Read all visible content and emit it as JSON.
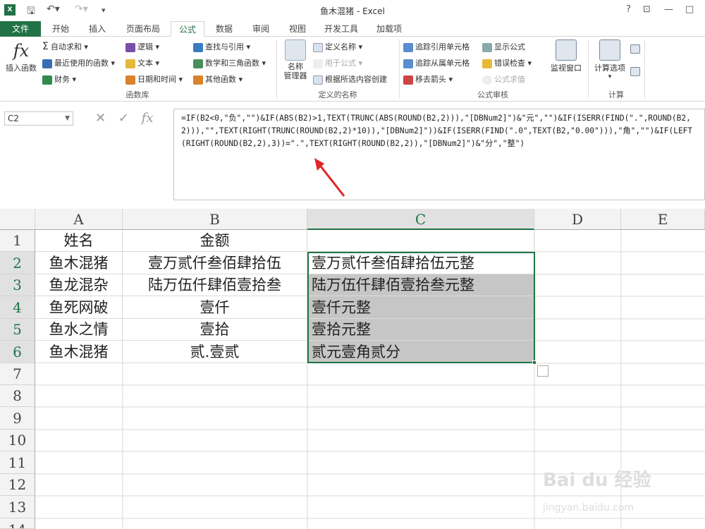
{
  "window": {
    "title": "鱼木混猪 - Excel",
    "help": "?",
    "restore_icon": "restore-icon",
    "min": "—",
    "max": "□"
  },
  "tabs": [
    "文件",
    "开始",
    "插入",
    "页面布局",
    "公式",
    "数据",
    "审阅",
    "视图",
    "开发工具",
    "加载项"
  ],
  "ribbon": {
    "insert_function": "插入函数",
    "autosum": "自动求和",
    "recent": "最近使用的函数",
    "financial": "财务",
    "logical": "逻辑",
    "text": "文本",
    "datetime": "日期和时间",
    "lookup": "查找与引用",
    "math": "数学和三角函数",
    "more": "其他函数",
    "group_function_library": "函数库",
    "name_manager": "名称\n管理器",
    "define_name": "定义名称",
    "use_in_formula": "用于公式",
    "create_from_selection": "根据所选内容创建",
    "group_defined_names": "定义的名称",
    "trace_precedents": "追踪引用单元格",
    "trace_dependents": "追踪从属单元格",
    "remove_arrows": "移去箭头",
    "show_formulas": "显示公式",
    "error_checking": "错误检查",
    "evaluate_formula": "公式求值",
    "group_formula_auditing": "公式审核",
    "watch_window": "监视窗口",
    "calc_options": "计算选项",
    "group_calculation": "计算"
  },
  "name_box": "C2",
  "formula": "=IF(B2<0,\"负\",\"\")&IF(ABS(B2)>1,TEXT(TRUNC(ABS(ROUND(B2,2))),\"[DBNum2]\")&\"元\",\"\")&IF(ISERR(FIND(\".\",ROUND(B2,2))),\"\",TEXT(RIGHT(TRUNC(ROUND(B2,2)*10)),\"[DBNum2]\"))&IF(ISERR(FIND(\".0\",TEXT(B2,\"0.00\"))),\"角\",\"\")&IF(LEFT(RIGHT(ROUND(B2,2),3))=\".\",TEXT(RIGHT(ROUND(B2,2)),\"[DBNum2]\")&\"分\",\"整\")",
  "columns": [
    "A",
    "B",
    "C",
    "D",
    "E"
  ],
  "rows": [
    "1",
    "2",
    "3",
    "4",
    "5",
    "6",
    "7",
    "8",
    "9",
    "10",
    "11",
    "12",
    "13",
    "14"
  ],
  "cells": {
    "r1": [
      "姓名",
      "金额",
      ""
    ],
    "r2": [
      "鱼木混猪",
      "壹万贰仟叁佰肆拾伍",
      "壹万贰仟叁佰肆拾伍元整"
    ],
    "r3": [
      "鱼龙混杂",
      "陆万伍仟肆佰壹拾叁",
      "陆万伍仟肆佰壹拾叁元整"
    ],
    "r4": [
      "鱼死网破",
      "壹仟",
      "壹仟元整"
    ],
    "r5": [
      "鱼水之情",
      "壹拾",
      "壹拾元整"
    ],
    "r6": [
      "鱼木混猪",
      "贰.壹贰",
      "贰元壹角贰分"
    ]
  },
  "watermark": {
    "logo": "Bai du 经验",
    "url": "jingyan.baidu.com"
  },
  "colors": {
    "excel_green": "#217346",
    "selection_shade": "#c6c6c6",
    "arrow": "#e0262b"
  }
}
